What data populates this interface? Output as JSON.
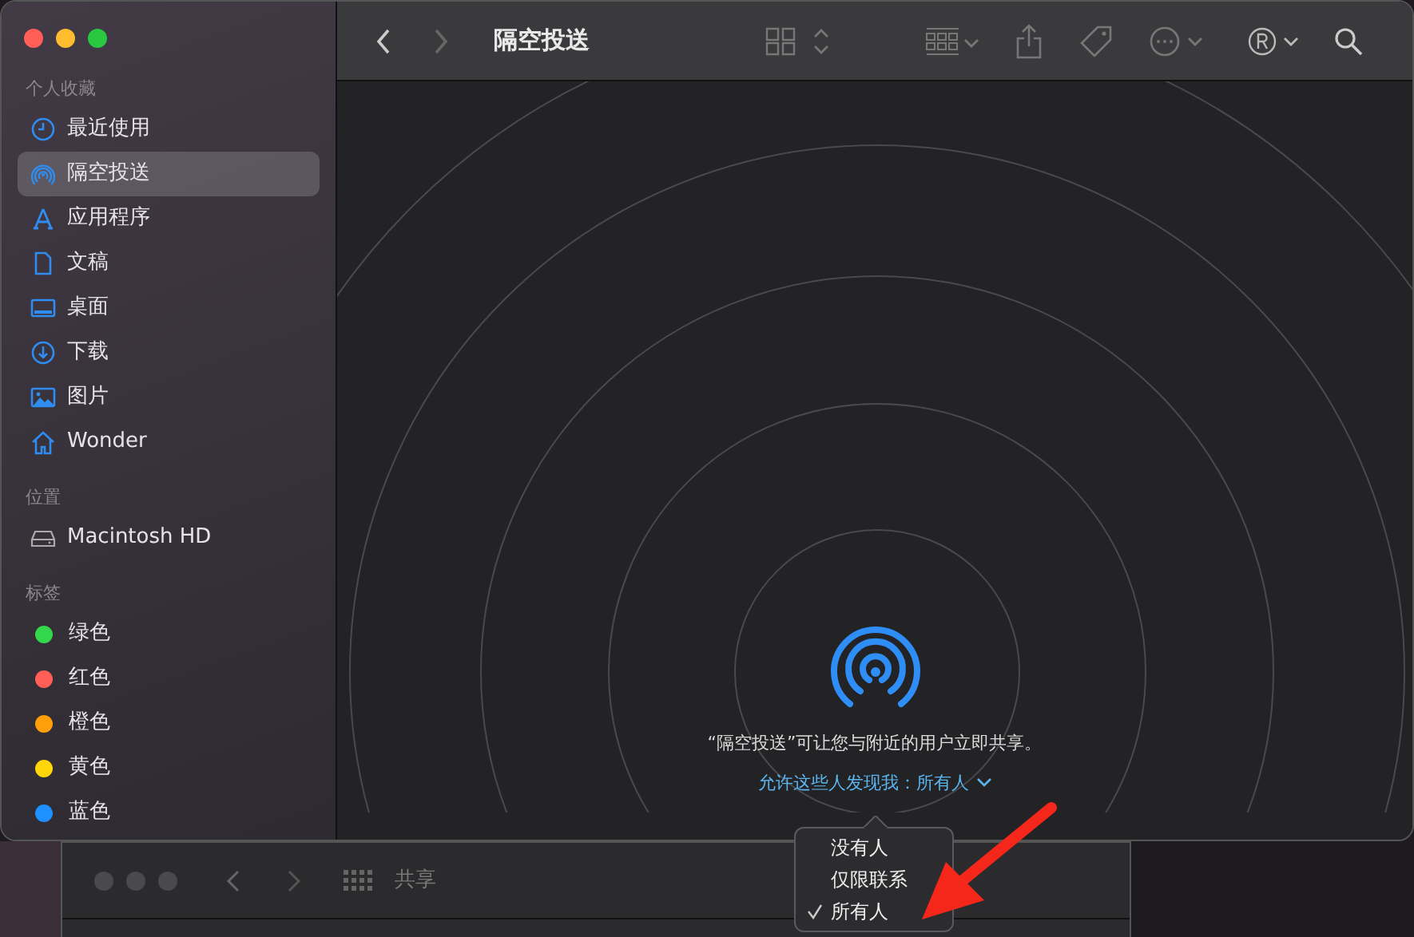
{
  "window": {
    "title": "隔空投送"
  },
  "sidebar": {
    "sections": [
      {
        "heading": "个人收藏",
        "items": [
          {
            "label": "最近使用",
            "kind": "clock",
            "selected": false
          },
          {
            "label": "隔空投送",
            "kind": "airdrop",
            "selected": true
          },
          {
            "label": "应用程序",
            "kind": "apps",
            "selected": false
          },
          {
            "label": "文稿",
            "kind": "document",
            "selected": false
          },
          {
            "label": "桌面",
            "kind": "desktop",
            "selected": false
          },
          {
            "label": "下载",
            "kind": "download",
            "selected": false
          },
          {
            "label": "图片",
            "kind": "picture",
            "selected": false
          },
          {
            "label": "Wonder",
            "kind": "home",
            "selected": false
          }
        ]
      },
      {
        "heading": "位置",
        "items": [
          {
            "label": "Macintosh HD",
            "kind": "disk",
            "selected": false
          }
        ]
      },
      {
        "heading": "标签",
        "items": [
          {
            "label": "绿色",
            "kind": "tag",
            "color": "#32d74b",
            "selected": false
          },
          {
            "label": "红色",
            "kind": "tag",
            "color": "#ff5f57",
            "selected": false
          },
          {
            "label": "橙色",
            "kind": "tag",
            "color": "#ff9f0a",
            "selected": false
          },
          {
            "label": "黄色",
            "kind": "tag",
            "color": "#ffd60a",
            "selected": false
          },
          {
            "label": "蓝色",
            "kind": "tag",
            "color": "#1e90ff",
            "selected": false
          }
        ]
      }
    ]
  },
  "toolbar": {
    "nav": [
      {
        "kind": "back",
        "disabled": false
      },
      {
        "kind": "forward",
        "disabled": true
      }
    ]
  },
  "airdrop": {
    "description": "“隔空投送”可让您与附近的用户立即共享。",
    "discover_link": "允许这些人发现我：所有人",
    "menu": [
      {
        "label": "没有人",
        "selected": false
      },
      {
        "label": "仅限联系",
        "selected": false
      },
      {
        "label": "所有人",
        "selected": true
      }
    ]
  },
  "background_window": {
    "title": "共享"
  }
}
